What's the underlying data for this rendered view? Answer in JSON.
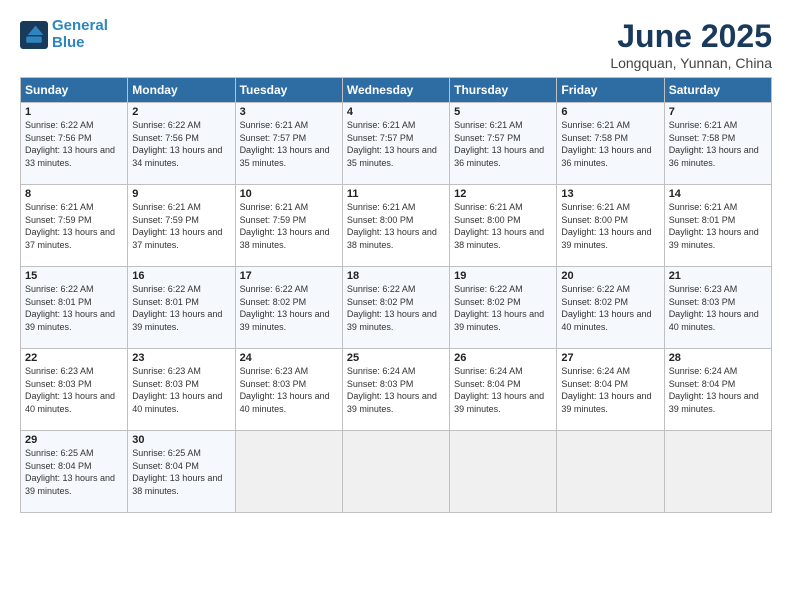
{
  "logo": {
    "line1": "General",
    "line2": "Blue"
  },
  "title": "June 2025",
  "location": "Longquan, Yunnan, China",
  "days_header": [
    "Sunday",
    "Monday",
    "Tuesday",
    "Wednesday",
    "Thursday",
    "Friday",
    "Saturday"
  ],
  "weeks": [
    [
      {
        "num": "1",
        "sunrise": "6:22 AM",
        "sunset": "7:56 PM",
        "daylight": "13 hours and 33 minutes."
      },
      {
        "num": "2",
        "sunrise": "6:22 AM",
        "sunset": "7:56 PM",
        "daylight": "13 hours and 34 minutes."
      },
      {
        "num": "3",
        "sunrise": "6:21 AM",
        "sunset": "7:57 PM",
        "daylight": "13 hours and 35 minutes."
      },
      {
        "num": "4",
        "sunrise": "6:21 AM",
        "sunset": "7:57 PM",
        "daylight": "13 hours and 35 minutes."
      },
      {
        "num": "5",
        "sunrise": "6:21 AM",
        "sunset": "7:57 PM",
        "daylight": "13 hours and 36 minutes."
      },
      {
        "num": "6",
        "sunrise": "6:21 AM",
        "sunset": "7:58 PM",
        "daylight": "13 hours and 36 minutes."
      },
      {
        "num": "7",
        "sunrise": "6:21 AM",
        "sunset": "7:58 PM",
        "daylight": "13 hours and 36 minutes."
      }
    ],
    [
      {
        "num": "8",
        "sunrise": "6:21 AM",
        "sunset": "7:59 PM",
        "daylight": "13 hours and 37 minutes."
      },
      {
        "num": "9",
        "sunrise": "6:21 AM",
        "sunset": "7:59 PM",
        "daylight": "13 hours and 37 minutes."
      },
      {
        "num": "10",
        "sunrise": "6:21 AM",
        "sunset": "7:59 PM",
        "daylight": "13 hours and 38 minutes."
      },
      {
        "num": "11",
        "sunrise": "6:21 AM",
        "sunset": "8:00 PM",
        "daylight": "13 hours and 38 minutes."
      },
      {
        "num": "12",
        "sunrise": "6:21 AM",
        "sunset": "8:00 PM",
        "daylight": "13 hours and 38 minutes."
      },
      {
        "num": "13",
        "sunrise": "6:21 AM",
        "sunset": "8:00 PM",
        "daylight": "13 hours and 39 minutes."
      },
      {
        "num": "14",
        "sunrise": "6:21 AM",
        "sunset": "8:01 PM",
        "daylight": "13 hours and 39 minutes."
      }
    ],
    [
      {
        "num": "15",
        "sunrise": "6:22 AM",
        "sunset": "8:01 PM",
        "daylight": "13 hours and 39 minutes."
      },
      {
        "num": "16",
        "sunrise": "6:22 AM",
        "sunset": "8:01 PM",
        "daylight": "13 hours and 39 minutes."
      },
      {
        "num": "17",
        "sunrise": "6:22 AM",
        "sunset": "8:02 PM",
        "daylight": "13 hours and 39 minutes."
      },
      {
        "num": "18",
        "sunrise": "6:22 AM",
        "sunset": "8:02 PM",
        "daylight": "13 hours and 39 minutes."
      },
      {
        "num": "19",
        "sunrise": "6:22 AM",
        "sunset": "8:02 PM",
        "daylight": "13 hours and 39 minutes."
      },
      {
        "num": "20",
        "sunrise": "6:22 AM",
        "sunset": "8:02 PM",
        "daylight": "13 hours and 40 minutes."
      },
      {
        "num": "21",
        "sunrise": "6:23 AM",
        "sunset": "8:03 PM",
        "daylight": "13 hours and 40 minutes."
      }
    ],
    [
      {
        "num": "22",
        "sunrise": "6:23 AM",
        "sunset": "8:03 PM",
        "daylight": "13 hours and 40 minutes."
      },
      {
        "num": "23",
        "sunrise": "6:23 AM",
        "sunset": "8:03 PM",
        "daylight": "13 hours and 40 minutes."
      },
      {
        "num": "24",
        "sunrise": "6:23 AM",
        "sunset": "8:03 PM",
        "daylight": "13 hours and 40 minutes."
      },
      {
        "num": "25",
        "sunrise": "6:24 AM",
        "sunset": "8:03 PM",
        "daylight": "13 hours and 39 minutes."
      },
      {
        "num": "26",
        "sunrise": "6:24 AM",
        "sunset": "8:04 PM",
        "daylight": "13 hours and 39 minutes."
      },
      {
        "num": "27",
        "sunrise": "6:24 AM",
        "sunset": "8:04 PM",
        "daylight": "13 hours and 39 minutes."
      },
      {
        "num": "28",
        "sunrise": "6:24 AM",
        "sunset": "8:04 PM",
        "daylight": "13 hours and 39 minutes."
      }
    ],
    [
      {
        "num": "29",
        "sunrise": "6:25 AM",
        "sunset": "8:04 PM",
        "daylight": "13 hours and 39 minutes."
      },
      {
        "num": "30",
        "sunrise": "6:25 AM",
        "sunset": "8:04 PM",
        "daylight": "13 hours and 38 minutes."
      },
      null,
      null,
      null,
      null,
      null
    ]
  ]
}
